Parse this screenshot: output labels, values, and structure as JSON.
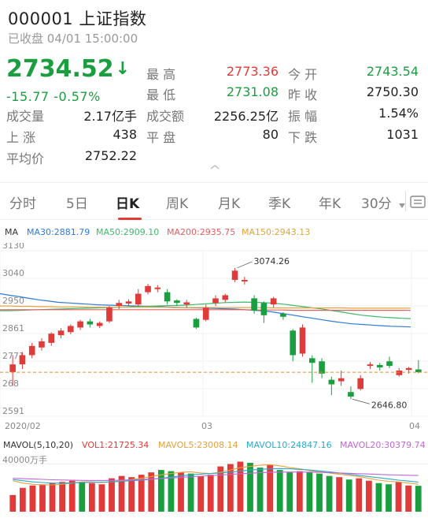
{
  "header": {
    "title": "000001 上证指数",
    "status": "已收盘 04/01 15:00:00",
    "price": "2734.52",
    "price_arrow": "↓",
    "change": "-15.77  -0.57%",
    "colors": {
      "up": "#e03b3b",
      "down": "#1a9e3f"
    }
  },
  "stats": {
    "high_label": "最 高",
    "high": "2773.36",
    "open_label": "今 开",
    "open": "2743.54",
    "low_label": "最 低",
    "low": "2731.08",
    "prev_label": "昨 收",
    "prev": "2750.30",
    "volume_label": "成交量",
    "volume": "2.17亿手",
    "amount_label": "成交额",
    "amount": "2256.25亿",
    "amp_label": "振 幅",
    "amp": "1.54%",
    "up_label": "上 涨",
    "up": "438",
    "flat_label": "平 盘",
    "flat": "80",
    "down_label": "下 跌",
    "down": "1031",
    "avg_label": "平均价",
    "avg": "2752.22"
  },
  "tabs": {
    "items": [
      "分时",
      "5日",
      "日K",
      "周K",
      "月K",
      "季K",
      "年K",
      "30分"
    ],
    "active_index": 2,
    "more_icon": "dropdown-triangle-icon",
    "settings_icon": "settings-icon"
  },
  "ma_legend": {
    "ma": "MA",
    "ma30": "MA30:2881.79",
    "ma50": "MA50:2909.10",
    "ma200": "MA200:2935.75",
    "ma150": "MA150:2943.13",
    "colors": {
      "ma30": "#2d7bd6",
      "ma50": "#3fb86b",
      "ma200": "#e06060",
      "ma150": "#e6a23c"
    }
  },
  "vol_legend": {
    "mavol": "MAVOL(5,10,20)",
    "vol1": "VOL1:21725.34",
    "mavol5": "MAVOL5:23008.14",
    "mavol10": "MAVOL10:24847.16",
    "mavol20": "MAVOL20:30379.74",
    "unit": "40000万手",
    "colors": {
      "vol1": "#e03b3b",
      "mavol5": "#e6a23c",
      "mavol10": "#2aa9c9",
      "mavol20": "#c266d6"
    }
  },
  "chart_data": {
    "type": "candlestick",
    "y_ticks": [
      "3130",
      "3040",
      "2950",
      "2861",
      "2771",
      "268",
      "2591"
    ],
    "x_labels": [
      "2020/02",
      "03",
      "04"
    ],
    "ylim": [
      2591,
      3130
    ],
    "annotations": {
      "high": "3074.26",
      "low": "2646.80"
    },
    "last_price": 2734.52,
    "candles": [
      {
        "o": 2735,
        "c": 2760,
        "h": 2790,
        "l": 2690
      },
      {
        "o": 2760,
        "c": 2790,
        "h": 2800,
        "l": 2745
      },
      {
        "o": 2790,
        "c": 2820,
        "h": 2830,
        "l": 2780
      },
      {
        "o": 2815,
        "c": 2835,
        "h": 2845,
        "l": 2805
      },
      {
        "o": 2830,
        "c": 2860,
        "h": 2865,
        "l": 2820
      },
      {
        "o": 2855,
        "c": 2870,
        "h": 2878,
        "l": 2845
      },
      {
        "o": 2865,
        "c": 2885,
        "h": 2890,
        "l": 2858
      },
      {
        "o": 2880,
        "c": 2900,
        "h": 2905,
        "l": 2872
      },
      {
        "o": 2900,
        "c": 2890,
        "h": 2908,
        "l": 2880
      },
      {
        "o": 2885,
        "c": 2895,
        "h": 2900,
        "l": 2878
      },
      {
        "o": 2900,
        "c": 2945,
        "h": 2950,
        "l": 2895
      },
      {
        "o": 2950,
        "c": 2960,
        "h": 2970,
        "l": 2940
      },
      {
        "o": 2958,
        "c": 2965,
        "h": 2972,
        "l": 2950
      },
      {
        "o": 2955,
        "c": 2990,
        "h": 3005,
        "l": 2948
      },
      {
        "o": 2995,
        "c": 3015,
        "h": 3022,
        "l": 2988
      },
      {
        "o": 3005,
        "c": 3010,
        "h": 3018,
        "l": 2995
      },
      {
        "o": 2995,
        "c": 2965,
        "h": 3005,
        "l": 2955
      },
      {
        "o": 2968,
        "c": 2960,
        "h": 2972,
        "l": 2950
      },
      {
        "o": 2955,
        "c": 2962,
        "h": 2970,
        "l": 2945
      },
      {
        "o": 2908,
        "c": 2880,
        "h": 2912,
        "l": 2875
      },
      {
        "o": 2905,
        "c": 2945,
        "h": 2955,
        "l": 2900
      },
      {
        "o": 2960,
        "c": 2975,
        "h": 2985,
        "l": 2950
      },
      {
        "o": 2970,
        "c": 2985,
        "h": 2990,
        "l": 2962
      },
      {
        "o": 3035,
        "c": 3065,
        "h": 3074,
        "l": 3028
      },
      {
        "o": 3030,
        "c": 3035,
        "h": 3045,
        "l": 3020
      },
      {
        "o": 2975,
        "c": 2935,
        "h": 2985,
        "l": 2925
      },
      {
        "o": 2960,
        "c": 2920,
        "h": 2965,
        "l": 2895
      },
      {
        "o": 2955,
        "c": 2975,
        "h": 2980,
        "l": 2945
      },
      {
        "o": 2925,
        "c": 2915,
        "h": 2930,
        "l": 2905
      },
      {
        "o": 2870,
        "c": 2790,
        "h": 2875,
        "l": 2770
      },
      {
        "o": 2795,
        "c": 2880,
        "h": 2890,
        "l": 2785
      },
      {
        "o": 2780,
        "c": 2765,
        "h": 2790,
        "l": 2700
      },
      {
        "o": 2770,
        "c": 2730,
        "h": 2780,
        "l": 2715
      },
      {
        "o": 2710,
        "c": 2695,
        "h": 2720,
        "l": 2660
      },
      {
        "o": 2705,
        "c": 2715,
        "h": 2740,
        "l": 2690
      },
      {
        "o": 2670,
        "c": 2655,
        "h": 2688,
        "l": 2646.8
      },
      {
        "o": 2680,
        "c": 2715,
        "h": 2725,
        "l": 2675
      },
      {
        "o": 2755,
        "c": 2760,
        "h": 2768,
        "l": 2745
      },
      {
        "o": 2758,
        "c": 2750,
        "h": 2765,
        "l": 2740
      },
      {
        "o": 2770,
        "c": 2755,
        "h": 2785,
        "l": 2748
      },
      {
        "o": 2725,
        "c": 2740,
        "h": 2748,
        "l": 2720
      },
      {
        "o": 2742,
        "c": 2748,
        "h": 2752,
        "l": 2730
      },
      {
        "o": 2743.54,
        "c": 2734.52,
        "h": 2773.36,
        "l": 2731.08
      }
    ],
    "ma_series": [
      {
        "name": "MA30",
        "values": [
          2990,
          2985,
          2980,
          2975,
          2970,
          2966,
          2962,
          2960,
          2958,
          2956,
          2954,
          2953,
          2952,
          2951,
          2950,
          2949,
          2948,
          2947,
          2946,
          2945,
          2944,
          2943,
          2942,
          2941,
          2940,
          2938,
          2936,
          2934,
          2930,
          2925,
          2920,
          2915,
          2910,
          2905,
          2900,
          2896,
          2892,
          2890,
          2888,
          2886,
          2884,
          2883,
          2881.79
        ]
      },
      {
        "name": "MA50",
        "values": [
          2935,
          2935,
          2936,
          2937,
          2938,
          2939,
          2940,
          2941,
          2942,
          2943,
          2944,
          2945,
          2946,
          2947,
          2948,
          2949,
          2950,
          2951,
          2952,
          2953,
          2955,
          2957,
          2959,
          2961,
          2962,
          2963,
          2962,
          2961,
          2959,
          2956,
          2952,
          2948,
          2944,
          2940,
          2935,
          2930,
          2925,
          2920,
          2917,
          2914,
          2912,
          2910,
          2909.1
        ]
      },
      {
        "name": "MA200",
        "values": [
          2938,
          2938,
          2938,
          2938,
          2938,
          2938,
          2938,
          2938,
          2938,
          2938,
          2938,
          2938,
          2938,
          2938,
          2938,
          2938,
          2938,
          2938,
          2938,
          2938,
          2938,
          2938,
          2938,
          2938,
          2938,
          2938,
          2937,
          2937,
          2937,
          2937,
          2936,
          2936,
          2936,
          2936,
          2936,
          2936,
          2936,
          2936,
          2936,
          2936,
          2936,
          2936,
          2935.75
        ]
      },
      {
        "name": "MA150",
        "values": [
          2950,
          2950,
          2949,
          2949,
          2948,
          2948,
          2947,
          2947,
          2947,
          2946,
          2946,
          2946,
          2946,
          2946,
          2946,
          2946,
          2946,
          2946,
          2945,
          2945,
          2945,
          2945,
          2945,
          2945,
          2945,
          2945,
          2945,
          2945,
          2944,
          2944,
          2944,
          2944,
          2944,
          2944,
          2944,
          2944,
          2943,
          2943,
          2943,
          2943,
          2943,
          2943,
          2943.13
        ]
      }
    ],
    "volumes": [
      14000,
      20000,
      22000,
      23000,
      24000,
      25000,
      26000,
      25000,
      24000,
      23000,
      28000,
      30000,
      29000,
      31000,
      33000,
      35000,
      34000,
      33000,
      32000,
      30000,
      31000,
      38000,
      40000,
      42000,
      41000,
      37000,
      39000,
      35000,
      33000,
      34000,
      33000,
      32000,
      30000,
      29000,
      27000,
      28000,
      26000,
      24000,
      23000,
      25000,
      22000,
      21725.34
    ],
    "mavol_series": [
      {
        "name": "MAVOL5",
        "values": [
          26000,
          24000,
          23000,
          22500,
          22500,
          23000,
          24000,
          25000,
          25000,
          24500,
          25000,
          26000,
          27000,
          28000,
          29500,
          31000,
          32000,
          33000,
          33500,
          32500,
          32000,
          33000,
          35000,
          37000,
          38000,
          39000,
          39500,
          38500,
          37000,
          36000,
          34500,
          33500,
          32500,
          31500,
          30500,
          29500,
          28000,
          26500,
          25500,
          25000,
          24000,
          23008.14
        ]
      },
      {
        "name": "MAVOL10",
        "values": [
          27000,
          26000,
          25000,
          24500,
          24000,
          24000,
          24200,
          24500,
          24700,
          24800,
          25000,
          25500,
          26000,
          26500,
          27200,
          28000,
          29000,
          30000,
          31000,
          31500,
          32000,
          32500,
          33200,
          34000,
          35000,
          35500,
          36000,
          36200,
          36000,
          35500,
          35000,
          34200,
          33500,
          32500,
          31500,
          30500,
          29500,
          28500,
          27500,
          26500,
          25700,
          24847.16
        ]
      },
      {
        "name": "MAVOL20",
        "values": [
          28000,
          27700,
          27400,
          27100,
          26800,
          26600,
          26400,
          26300,
          26200,
          26200,
          26300,
          26500,
          26700,
          27000,
          27400,
          27800,
          28300,
          28800,
          29300,
          29800,
          30300,
          30800,
          31300,
          31800,
          32300,
          32700,
          33000,
          33200,
          33300,
          33300,
          33200,
          33000,
          32800,
          32500,
          32200,
          31900,
          31600,
          31300,
          31000,
          30800,
          30600,
          30379.74
        ]
      }
    ],
    "vol_max": 45000
  }
}
